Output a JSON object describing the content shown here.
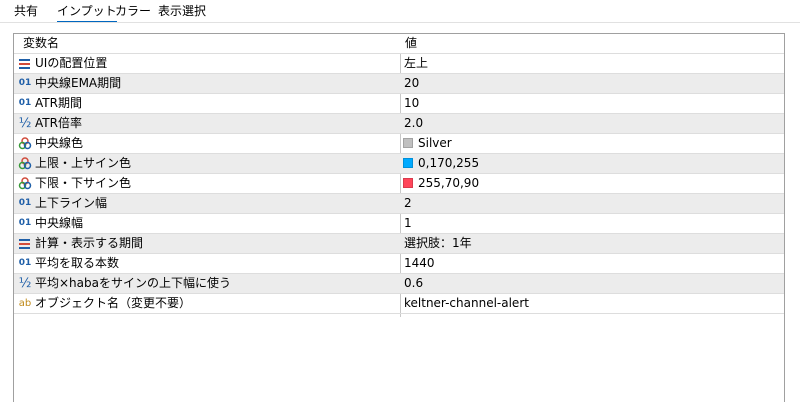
{
  "tabs": [
    {
      "label": "共有"
    },
    {
      "label": "インプット"
    },
    {
      "label": "カラー"
    },
    {
      "label": "表示選択"
    }
  ],
  "table": {
    "header": {
      "name": "変数名",
      "value": "値"
    },
    "rows": [
      {
        "icon": "enum-icon",
        "name": "UIの配置位置",
        "value": "左上"
      },
      {
        "icon": "integer-icon",
        "icon_text": "01",
        "name": "中央線EMA期間",
        "value": "20"
      },
      {
        "icon": "integer-icon",
        "icon_text": "01",
        "name": "ATR期間",
        "value": "10"
      },
      {
        "icon": "fraction-icon",
        "icon_text": "½",
        "name": "ATR倍率",
        "value": "2.0"
      },
      {
        "icon": "color-icon",
        "name": "中央線色",
        "value": "Silver",
        "swatch": "#c0c0c0"
      },
      {
        "icon": "color-icon",
        "name": "上限・上サイン色",
        "value": "0,170,255",
        "swatch": "#00aaff"
      },
      {
        "icon": "color-icon",
        "name": "下限・下サイン色",
        "value": "255,70,90",
        "swatch": "#ff465a"
      },
      {
        "icon": "integer-icon",
        "icon_text": "01",
        "name": "上下ライン幅",
        "value": "2"
      },
      {
        "icon": "integer-icon",
        "icon_text": "01",
        "name": "中央線幅",
        "value": "1"
      },
      {
        "icon": "enum-icon",
        "name": "計算・表示する期間",
        "value": "選択肢：1年"
      },
      {
        "icon": "integer-icon",
        "icon_text": "01",
        "name": "平均を取る本数",
        "value": "1440"
      },
      {
        "icon": "fraction-icon",
        "icon_text": "½",
        "name": "平均×habaをサインの上下幅に使う",
        "value": "0.6"
      },
      {
        "icon": "string-icon",
        "icon_text": "ab",
        "name": "オブジェクト名（変更不要）",
        "value": "keltner-channel-alert"
      }
    ]
  },
  "colors": {
    "accent": "#0067c0",
    "icon_blue": "#1f5fa8",
    "icon_gold": "#c08a1a"
  }
}
